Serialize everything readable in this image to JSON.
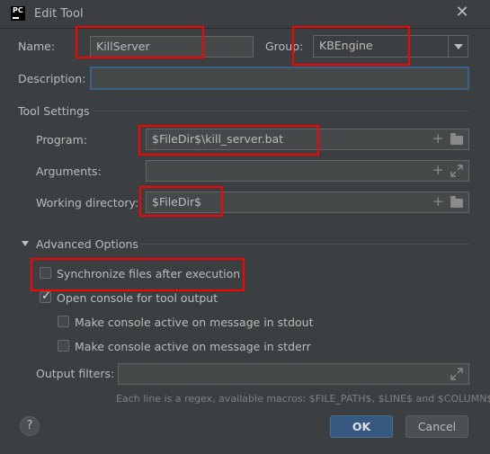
{
  "window": {
    "title": "Edit Tool",
    "app_icon_text": "PC",
    "close_glyph": "✕"
  },
  "form": {
    "name_label": "Name:",
    "name_value": "KillServer",
    "group_label": "Group:",
    "group_value": "KBEngine",
    "description_label": "Description:",
    "description_value": ""
  },
  "tool_settings": {
    "section_label": "Tool Settings",
    "program_label": "Program:",
    "program_value": "$FileDir$\\kill_server.bat",
    "arguments_label": "Arguments:",
    "arguments_value": "",
    "working_dir_label": "Working directory:",
    "working_dir_value": "$FileDir$"
  },
  "advanced": {
    "section_label": "Advanced Options",
    "sync_label": "Synchronize files after execution",
    "sync_checked": false,
    "open_console_label": "Open console for tool output",
    "open_console_checked": true,
    "active_stdout_label": "Make console active on message in stdout",
    "active_stdout_checked": false,
    "active_stderr_label": "Make console active on message in stderr",
    "active_stderr_checked": false,
    "output_filters_label": "Output filters:",
    "output_filters_value": "",
    "hint": "Each line is a regex, available macros: $FILE_PATH$, $LINE$ and $COLUMN$"
  },
  "footer": {
    "help_glyph": "?",
    "ok_label": "OK",
    "cancel_label": "Cancel"
  },
  "icons": {
    "plus": "+",
    "checkmark": "✓"
  },
  "colors": {
    "background": "#3c3f41",
    "field": "#45494a",
    "focus_border": "#3d6185",
    "primary_button": "#365880",
    "annotation_red": "#ff0000"
  }
}
